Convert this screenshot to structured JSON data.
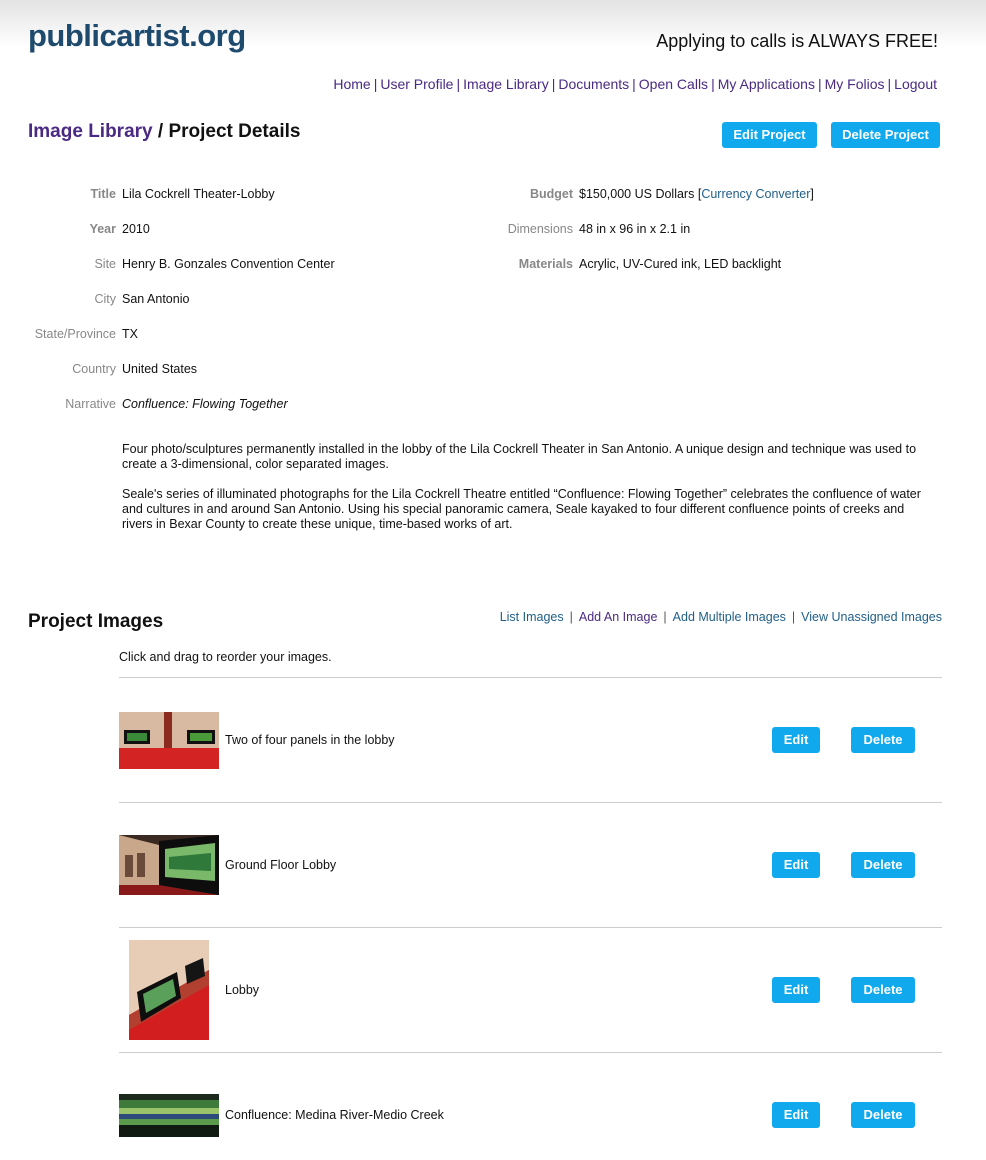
{
  "header": {
    "logo": "publicartist.org",
    "tagline": "Applying to calls is ALWAYS FREE!"
  },
  "nav": [
    "Home",
    "User Profile",
    "Image Library",
    "Documents",
    "Open Calls",
    "My Applications",
    "My Folios",
    "Logout"
  ],
  "page": {
    "breadcrumb": "Image Library",
    "title": "Project Details",
    "edit_label": "Edit Project",
    "delete_label": "Delete Project"
  },
  "details": {
    "title_label": "Title",
    "title": "Lila Cockrell Theater-Lobby",
    "year_label": "Year",
    "year": "2010",
    "site_label": "Site",
    "site": "Henry B. Gonzales Convention Center",
    "city_label": "City",
    "city": "San Antonio",
    "state_label": "State/Province",
    "state": "TX",
    "country_label": "Country",
    "country": "United States",
    "narrative_label": "Narrative",
    "narrative": "Confluence: Flowing Together",
    "budget_label": "Budget",
    "budget": "$150,000 US Dollars",
    "currency_link": "Currency Converter",
    "dimensions_label": "Dimensions",
    "dimensions": "48 in x 96 in x 2.1 in",
    "materials_label": "Materials",
    "materials": "Acrylic, UV-Cured ink, LED backlight"
  },
  "description": {
    "p1": "Four photo/sculptures permanently installed in the lobby of the Lila Cockrell Theater in San Antonio. A unique design and technique was used to create a 3-dimensional, color separated images.",
    "p2": "Seale's series of illuminated photographs for the Lila Cockrell Theatre entitled “Confluence: Flowing Together” celebrates the confluence of water and cultures in and around San Antonio. Using his special panoramic camera, Seale kayaked to four different confluence points of creeks and rivers in Bexar County to create these unique, time-based works of art."
  },
  "images_section": {
    "title": "Project Images",
    "links": [
      "List Images",
      "Add An Image",
      "Add Multiple Images",
      "View Unassigned Images"
    ],
    "hint": "Click and drag to reorder your images.",
    "edit_label": "Edit",
    "delete_label": "Delete",
    "items": [
      {
        "caption": "Two of four panels in the lobby"
      },
      {
        "caption": "Ground Floor Lobby"
      },
      {
        "caption": "Lobby"
      },
      {
        "caption": "Confluence: Medina River-Medio Creek"
      }
    ]
  },
  "colors": {
    "accent": "#11a9ee",
    "link_purple": "#4a2a83",
    "link_blue": "#1f5f8a",
    "logo": "#1e4a6e"
  }
}
